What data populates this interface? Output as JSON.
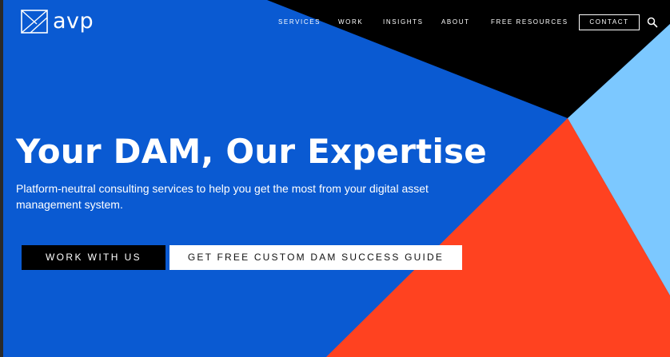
{
  "brand": {
    "name": "avp",
    "logo_icon": "avp-logo-mark"
  },
  "nav": {
    "items": [
      {
        "label": "SERVICES"
      },
      {
        "label": "WORK"
      },
      {
        "label": "INSIGHTS"
      },
      {
        "label": "ABOUT"
      },
      {
        "label": "FREE RESOURCES"
      }
    ],
    "contact_label": "CONTACT",
    "search_icon": "search-icon"
  },
  "hero": {
    "title": "Your DAM, Our Expertise",
    "subtitle": "Platform-neutral consulting services to help you get the most from your digital asset management system.",
    "primary_cta": "WORK WITH US",
    "secondary_cta": "GET FREE CUSTOM DAM SUCCESS GUIDE"
  },
  "colors": {
    "page_frame": "#2a2a2a",
    "hero_blue": "#0a5ad2",
    "black_wedge": "#000000",
    "light_blue_wedge": "#7cc8ff",
    "orange_wedge": "#ff4220",
    "button_dark": "#000000",
    "button_light": "#ffffff"
  }
}
